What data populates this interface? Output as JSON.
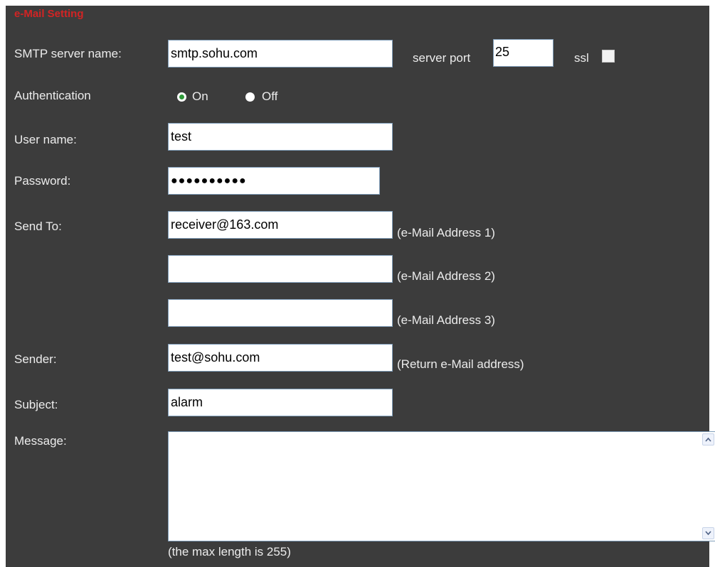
{
  "panel": {
    "title": "e-Mail Setting"
  },
  "smtp": {
    "label": "SMTP server name:",
    "value": "smtp.sohu.com",
    "port_label": "server port",
    "port_value": "25",
    "ssl_label": "ssl",
    "ssl_checked": false
  },
  "authentication": {
    "label": "Authentication",
    "on_label": "On",
    "off_label": "Off",
    "selected": "On"
  },
  "username": {
    "label": "User name:",
    "value": "test"
  },
  "password": {
    "label": "Password:",
    "masked_value": "●●●●●●●●●●"
  },
  "send_to": {
    "label": "Send To:",
    "addresses": [
      {
        "value": "receiver@163.com",
        "hint": "(e-Mail Address 1)"
      },
      {
        "value": "",
        "hint": "(e-Mail Address 2)"
      },
      {
        "value": "",
        "hint": "(e-Mail Address 3)"
      }
    ]
  },
  "sender": {
    "label": "Sender:",
    "value": "test@sohu.com",
    "hint": "(Return e-Mail address)"
  },
  "subject": {
    "label": "Subject:",
    "value": "alarm"
  },
  "message": {
    "label": "Message:",
    "value": "",
    "note": "(the max length is 255)"
  },
  "colors": {
    "panel_bg": "#3c3c3c",
    "title": "#d22424",
    "label_text": "#ececec",
    "field_border": "#7f9db9",
    "radio_selected": "#2f9a3a"
  },
  "icons": {
    "scroll_up": "chevron-up-icon",
    "scroll_down": "chevron-down-icon"
  }
}
